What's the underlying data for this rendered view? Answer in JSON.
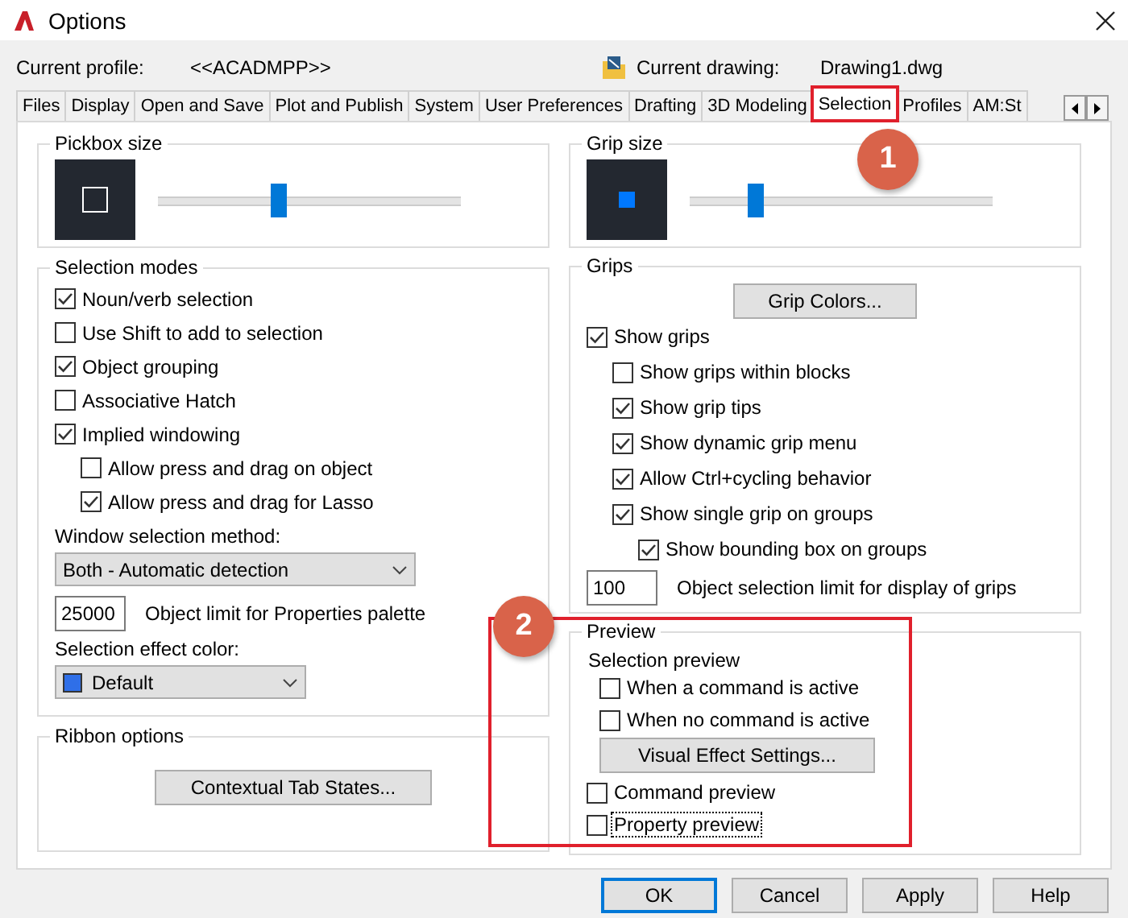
{
  "window": {
    "title": "Options"
  },
  "profile": {
    "label": "Current profile:",
    "value": "<<ACADMPP>>"
  },
  "drawing": {
    "label": "Current drawing:",
    "value": "Drawing1.dwg"
  },
  "tabs": [
    {
      "label": "Files",
      "selected": false,
      "highlighted": false
    },
    {
      "label": "Display",
      "selected": false,
      "highlighted": false
    },
    {
      "label": "Open and Save",
      "selected": false,
      "highlighted": false
    },
    {
      "label": "Plot and Publish",
      "selected": false,
      "highlighted": false
    },
    {
      "label": "System",
      "selected": false,
      "highlighted": false
    },
    {
      "label": "User Preferences",
      "selected": false,
      "highlighted": false
    },
    {
      "label": "Drafting",
      "selected": false,
      "highlighted": false
    },
    {
      "label": "3D Modeling",
      "selected": false,
      "highlighted": false
    },
    {
      "label": "Selection",
      "selected": true,
      "highlighted": true
    },
    {
      "label": "Profiles",
      "selected": false,
      "highlighted": false
    },
    {
      "label": "AM:St",
      "selected": false,
      "highlighted": false
    }
  ],
  "pickbox": {
    "title": "Pickbox size",
    "level": 0.4
  },
  "selection_modes": {
    "title": "Selection modes",
    "options": [
      {
        "label": "Noun/verb selection",
        "checked": true
      },
      {
        "label": "Use Shift to add to selection",
        "checked": false
      },
      {
        "label": "Object grouping",
        "checked": true
      },
      {
        "label": "Associative Hatch",
        "checked": false
      },
      {
        "label": "Implied windowing",
        "checked": true,
        "children": [
          {
            "label": "Allow press and drag on object",
            "checked": false
          },
          {
            "label": "Allow press and drag for Lasso",
            "checked": true
          }
        ]
      }
    ],
    "window_method": {
      "label": "Window selection method:",
      "value": "Both - Automatic detection"
    },
    "object_limit": {
      "value": "25000",
      "label": "Object limit for Properties palette"
    },
    "effect_color": {
      "label": "Selection effect color:",
      "value": "Default",
      "color": "#2f6fe8"
    }
  },
  "ribbon": {
    "title": "Ribbon options",
    "button": "Contextual Tab States..."
  },
  "grip_size": {
    "title": "Grip size",
    "level": 0.22
  },
  "grips": {
    "title": "Grips",
    "button": "Grip Colors...",
    "options": [
      {
        "label": "Show grips",
        "checked": true,
        "children": [
          {
            "label": "Show grips within blocks",
            "checked": false
          },
          {
            "label": "Show grip tips",
            "checked": true
          },
          {
            "label": "Show dynamic grip menu",
            "checked": true
          },
          {
            "label": "Allow Ctrl+cycling behavior",
            "checked": true
          },
          {
            "label": "Show single grip on groups",
            "checked": true,
            "children": [
              {
                "label": "Show bounding box on groups",
                "checked": true
              }
            ]
          }
        ]
      }
    ],
    "limit": {
      "value": "100",
      "label": "Object selection limit for display of grips"
    }
  },
  "preview": {
    "title": "Preview",
    "highlighted": true,
    "subtitle": "Selection preview",
    "sub_options": [
      {
        "label": "When a command is active",
        "checked": false
      },
      {
        "label": "When no command is active",
        "checked": false
      }
    ],
    "button": "Visual Effect Settings...",
    "options": [
      {
        "label": "Command preview",
        "checked": false,
        "focused": false
      },
      {
        "label": "Property preview",
        "checked": false,
        "focused": true
      }
    ]
  },
  "buttons": [
    {
      "label": "OK",
      "default": true
    },
    {
      "label": "Cancel",
      "default": false
    },
    {
      "label": "Apply",
      "default": false
    },
    {
      "label": "Help",
      "default": false
    }
  ],
  "callouts": [
    {
      "label": "1"
    },
    {
      "label": "2"
    }
  ]
}
